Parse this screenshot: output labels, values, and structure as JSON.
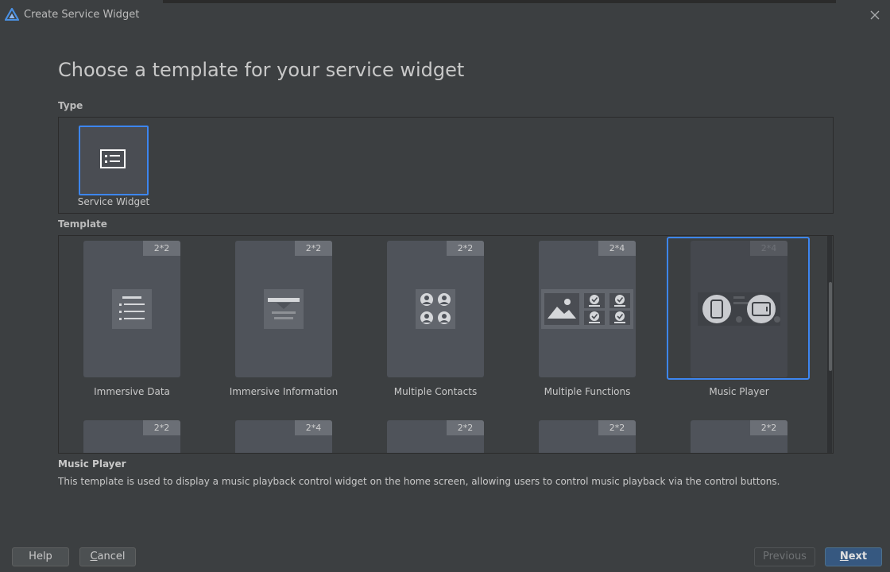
{
  "window": {
    "title": "Create Service Widget"
  },
  "heading": "Choose a template for your service widget",
  "type_section": {
    "label": "Type",
    "items": [
      {
        "label": "Service Widget",
        "icon": "list-card-icon",
        "selected": true
      }
    ]
  },
  "template_section": {
    "label": "Template",
    "items": [
      {
        "label": "Immersive Data",
        "size": "2*2",
        "icon": "list-lines-icon"
      },
      {
        "label": "Immersive Information",
        "size": "2*2",
        "icon": "text-block-icon"
      },
      {
        "label": "Multiple Contacts",
        "size": "2*2",
        "icon": "contacts-grid-icon"
      },
      {
        "label": "Multiple Functions",
        "size": "2*4",
        "icon": "image-and-checks-icon"
      },
      {
        "label": "Music Player",
        "size": "2*4",
        "icon": "music-player-devices-icon",
        "selected": true
      }
    ],
    "second_row_sizes": [
      "2*2",
      "2*4",
      "2*2",
      "2*2",
      "2*2"
    ]
  },
  "description": {
    "title": "Music Player",
    "text": "This template is used to display a music playback control widget on the home screen, allowing users to control music playback via the control buttons."
  },
  "buttons": {
    "help": "Help",
    "cancel_mnemonic": "C",
    "cancel_rest": "ancel",
    "previous": "Previous",
    "next_mnemonic": "N",
    "next_rest": "ext"
  },
  "colors": {
    "accent": "#3d86f0",
    "background": "#3c3f41",
    "tile": "#4f535a"
  }
}
